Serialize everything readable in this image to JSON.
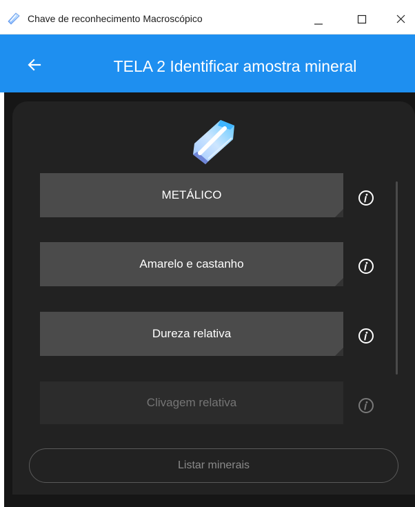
{
  "window": {
    "title": "Chave de reconhecimento Macroscópico",
    "icons": [
      "app-crystal-icon",
      "minimize-icon",
      "maximize-icon",
      "close-icon"
    ]
  },
  "appbar": {
    "title": "TELA 2 Identificar amostra mineral",
    "back_icon": "arrow-left-icon",
    "color": "#1e8ff0"
  },
  "options": [
    {
      "label": "METÁLICO",
      "enabled": true
    },
    {
      "label": "Amarelo e castanho",
      "enabled": true
    },
    {
      "label": "Dureza relativa",
      "enabled": true
    },
    {
      "label": "Clivagem relativa",
      "enabled": false
    }
  ],
  "list_button": {
    "label": "Listar minerais"
  },
  "colors": {
    "background": "#161616",
    "card": "#222222",
    "button": "#4b4b4b",
    "button_disabled": "#2c2c2c"
  }
}
